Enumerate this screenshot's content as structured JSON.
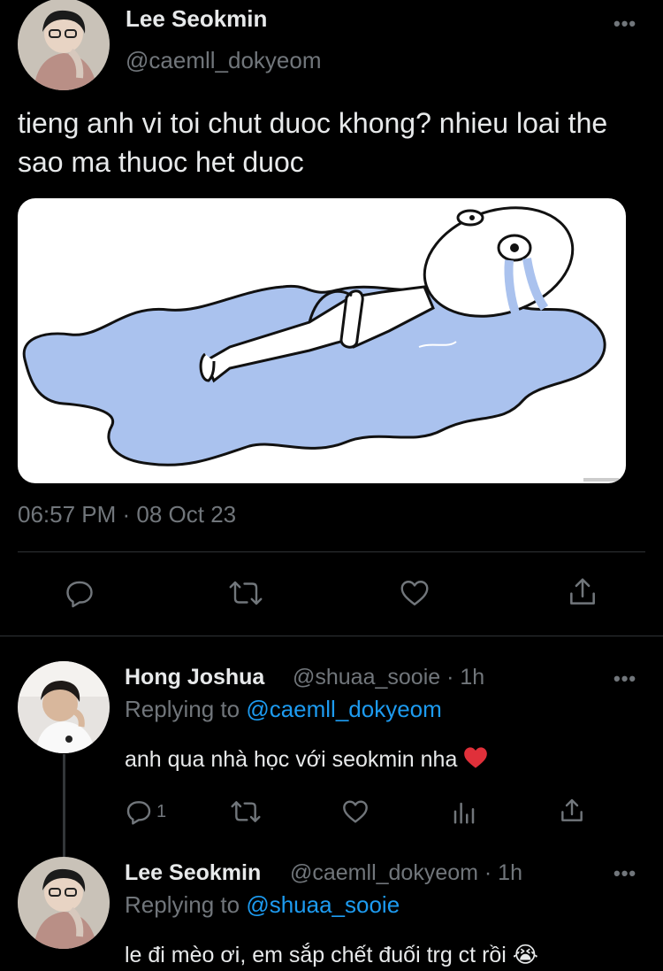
{
  "main_tweet": {
    "author_name": "Lee Seokmin",
    "author_handle": "@caemll_dokyeom",
    "text": "tieng anh vi toi chut duoc khong? nhieu loai the sao ma thuoc het duoc",
    "timestamp": "06:57 PM · 08 Oct 23",
    "more_icon": "more-horizontal-icon"
  },
  "replies": [
    {
      "author_name": "Hong Joshua",
      "author_handle": "@shuaa_sooie · 1h",
      "replying_prefix": "Replying to ",
      "replying_handle": "@caemll_dokyeom",
      "text": "anh qua nhà học với seokmin nha",
      "reply_count": "1"
    },
    {
      "author_name": "Lee Seokmin",
      "author_handle": "@caemll_dokyeom · 1h",
      "replying_prefix": "Replying to ",
      "replying_handle": "@shuaa_sooie",
      "text": "le đi mèo ơi, em sắp chết đuối trg ct rồi 😭"
    }
  ],
  "colors": {
    "background": "#000000",
    "text": "#e7e9ea",
    "secondary": "#71767b",
    "link": "#1d9bf0",
    "heart_emoji": "#e0303a"
  }
}
